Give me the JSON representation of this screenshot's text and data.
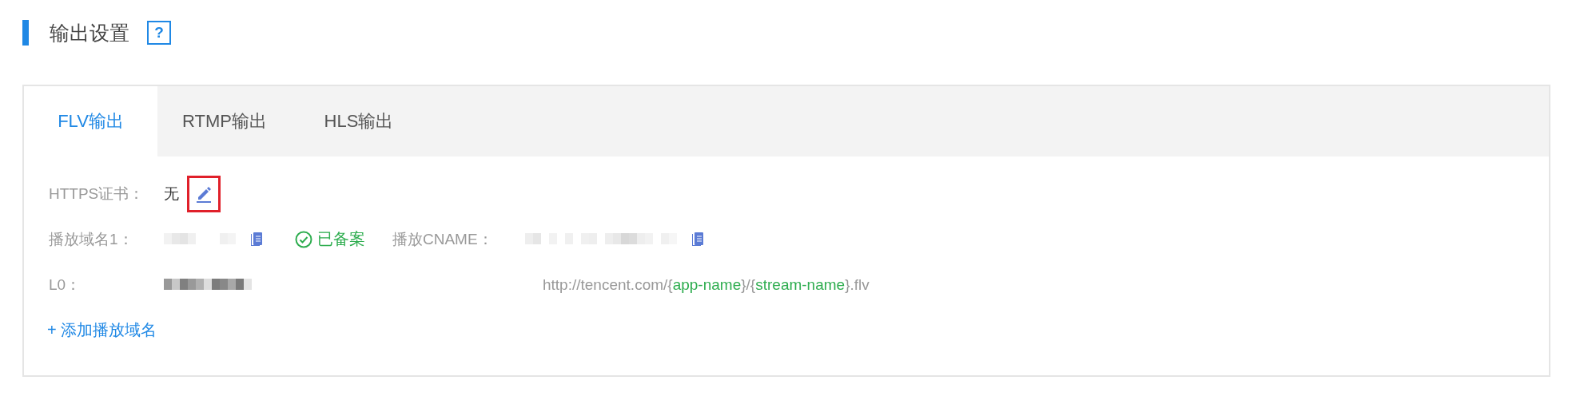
{
  "section": {
    "title": "输出设置",
    "help": "?"
  },
  "tabs": [
    {
      "label": "FLV输出",
      "selected": true
    },
    {
      "label": "RTMP输出",
      "selected": false
    },
    {
      "label": "HLS输出",
      "selected": false
    }
  ],
  "https": {
    "label": "HTTPS证书：",
    "value": "无"
  },
  "domain": {
    "label": "播放域名1：",
    "status": "已备案",
    "cname_label": "播放CNAME："
  },
  "address": {
    "label": "L0：",
    "url_parts": [
      {
        "text": "http://tencent.com/{",
        "kind": "plain"
      },
      {
        "text": "app-name",
        "kind": "param"
      },
      {
        "text": "}/{",
        "kind": "plain"
      },
      {
        "text": "stream-name",
        "kind": "param"
      },
      {
        "text": "}.flv",
        "kind": "plain"
      }
    ]
  },
  "add_link": "+ 添加播放域名"
}
